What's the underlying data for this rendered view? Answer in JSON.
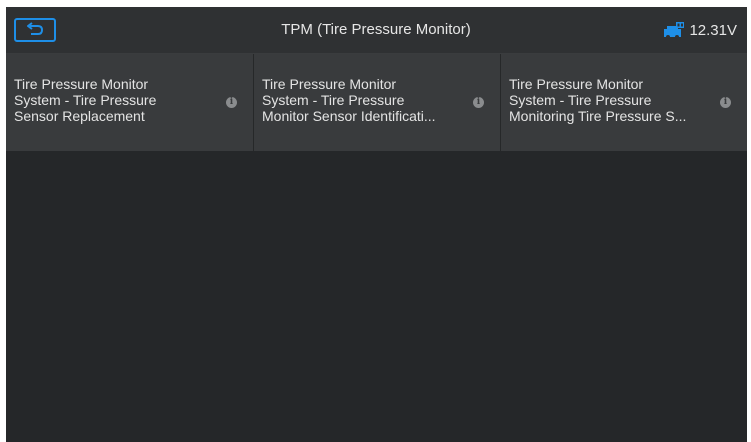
{
  "header": {
    "title": "TPM (Tire Pressure Monitor)",
    "voltage": "12.31V",
    "back_icon": "back-arrow-icon",
    "battery_icon": "vehicle-battery-icon"
  },
  "menu": {
    "items": [
      {
        "label": "Tire Pressure Monitor\nSystem - Tire Pressure\nSensor Replacement",
        "info_icon": "info-icon"
      },
      {
        "label": "Tire Pressure Monitor\nSystem - Tire Pressure\nMonitor Sensor Identificati...",
        "info_icon": "info-icon"
      },
      {
        "label": "Tire Pressure Monitor\nSystem - Tire Pressure\nMonitoring Tire Pressure S...",
        "info_icon": "info-icon"
      }
    ]
  },
  "colors": {
    "accent": "#1e8fe8",
    "header_bg": "#2f3133",
    "tile_bg": "#393b3d",
    "screen_bg": "#252729"
  }
}
